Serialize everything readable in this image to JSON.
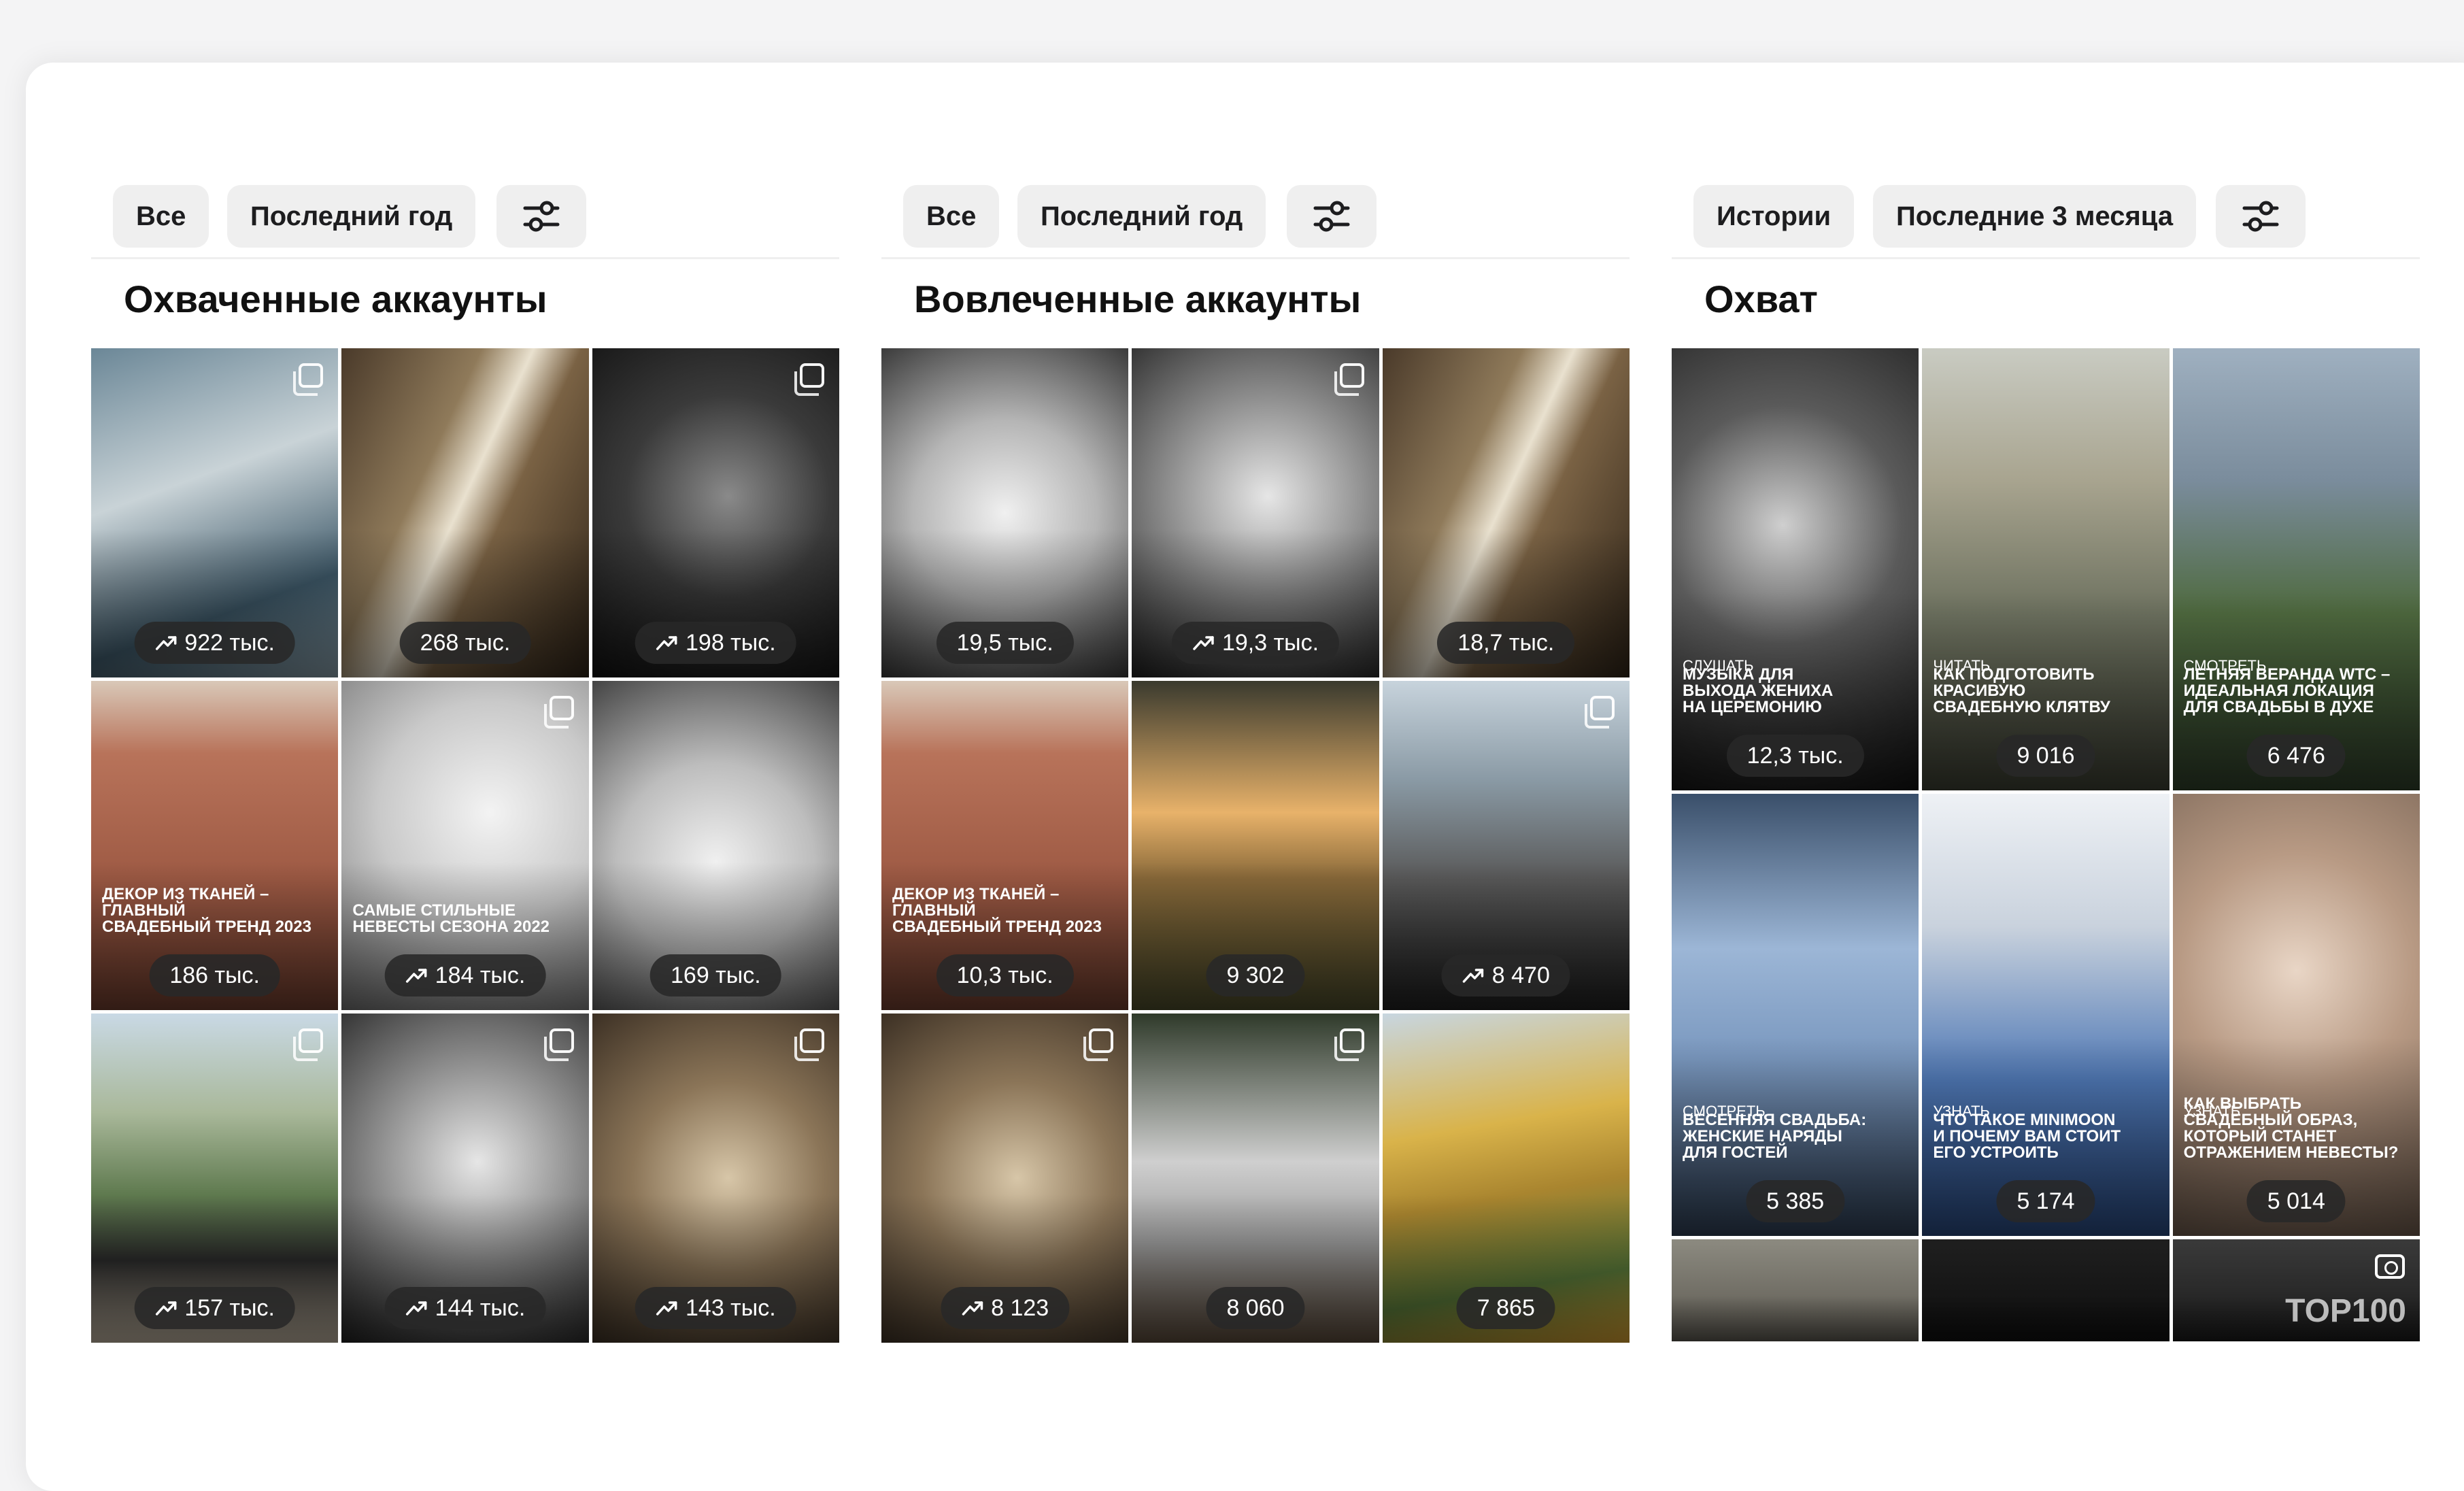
{
  "columns": [
    {
      "chips": [
        "Все",
        "Последний год"
      ],
      "title": "Охваченные аккаунты",
      "tiles": [
        {
          "value": "922 тыс.",
          "trend": true,
          "caption": "",
          "tag": "",
          "badge": true,
          "bg": "linear-gradient(160deg,#6b8797 0%,#c9d3d7 40%,#3f5a6a 75%,#8aa0ab 100%)"
        },
        {
          "value": "268 тыс.",
          "trend": false,
          "caption": "",
          "tag": "",
          "badge": false,
          "bg": "linear-gradient(115deg,#4a3a2a 0%,#8f7a5a 35%,#e9e1cf 48%,#7a6244 60%,#2f2418 100%)"
        },
        {
          "value": "198 тыс.",
          "trend": true,
          "caption": "",
          "tag": "",
          "badge": true,
          "bg": "radial-gradient(circle at 55% 45%,#8a8a8a 0%,#3a3a3a 45%,#111 100%)"
        },
        {
          "value": "186 тыс.",
          "trend": false,
          "caption": "ДЕКОР ИЗ ТКАНЕЙ – ГЛАВНЫЙ\nСВАДЕБНЫЙ ТРЕНД 2023",
          "tag": "",
          "badge": false,
          "bg": "linear-gradient(180deg,#d9c8b8 0%,#b8735a 22%,#9e5a44 60%,#6e3d2e 100%)"
        },
        {
          "value": "184 тыс.",
          "trend": true,
          "caption": "САМЫЕ СТИЛЬНЫЕ\nНЕВЕСТЫ СЕЗОНА 2022",
          "tag": "",
          "badge": true,
          "bg": "radial-gradient(circle at 60% 40%,#f3f3f3 0%,#c9c9c9 45%,#6d6d6d 100%)"
        },
        {
          "value": "169 тыс.",
          "trend": false,
          "caption": "",
          "tag": "",
          "badge": false,
          "bg": "radial-gradient(circle at 50% 55%,#f0f0f0 0%,#bdbdbd 45%,#444 100%)"
        },
        {
          "value": "157 тыс.",
          "trend": true,
          "caption": "",
          "tag": "",
          "badge": true,
          "bg": "linear-gradient(180deg,#c9d9e5 0%,#a9b89a 30%,#5f7a4f 55%,#2a2a2a 75%,#bfb3a0 100%)"
        },
        {
          "value": "144 тыс.",
          "trend": true,
          "caption": "",
          "tag": "",
          "badge": true,
          "bg": "radial-gradient(circle at 55% 45%,#e6e6e6 0%,#8c8c8c 45%,#1f1f1f 100%)"
        },
        {
          "value": "143 тыс.",
          "trend": true,
          "caption": "",
          "tag": "",
          "badge": true,
          "bg": "radial-gradient(circle at 55% 50%,#d7c6a8 0%,#8b7558 45%,#3c3024 100%)"
        }
      ]
    },
    {
      "chips": [
        "Все",
        "Последний год"
      ],
      "title": "Вовлеченные аккаунты",
      "tiles": [
        {
          "value": "19,5 тыс.",
          "trend": false,
          "caption": "",
          "tag": "",
          "badge": false,
          "bg": "radial-gradient(circle at 50% 50%,#f0f0f0 0%,#b5b5b5 45%,#3b3b3b 100%)"
        },
        {
          "value": "19,3 тыс.",
          "trend": true,
          "caption": "",
          "tag": "",
          "badge": true,
          "bg": "radial-gradient(circle at 55% 45%,#e6e6e6 0%,#8c8c8c 45%,#1f1f1f 100%)"
        },
        {
          "value": "18,7 тыс.",
          "trend": false,
          "caption": "",
          "tag": "",
          "badge": false,
          "bg": "linear-gradient(115deg,#4a3a2a 0%,#8f7a5a 35%,#e9e1cf 48%,#7a6244 60%,#2f2418 100%)"
        },
        {
          "value": "10,3 тыс.",
          "trend": false,
          "caption": "ДЕКОР ИЗ ТКАНЕЙ – ГЛАВНЫЙ\nСВАДЕБНЫЙ ТРЕНД 2023",
          "tag": "",
          "badge": false,
          "bg": "linear-gradient(180deg,#d9c8b8 0%,#b8735a 22%,#9e5a44 60%,#6e3d2e 100%)"
        },
        {
          "value": "9 302",
          "trend": false,
          "caption": "",
          "tag": "",
          "badge": false,
          "bg": "linear-gradient(180deg,#3a3a2e 0%,#e8b26a 40%,#8a6a3a 60%,#4a4a2a 100%)"
        },
        {
          "value": "8 470",
          "trend": true,
          "caption": "",
          "tag": "",
          "badge": true,
          "bg": "linear-gradient(180deg,#c7d3dc 0%,#8a9aa5 30%,#5a5a5a 60%,#1f1f1f 100%)"
        },
        {
          "value": "8 123",
          "trend": true,
          "caption": "",
          "tag": "",
          "badge": true,
          "bg": "radial-gradient(circle at 55% 50%,#d7c6a8 0%,#8b7558 45%,#3c3024 100%)"
        },
        {
          "value": "8 060",
          "trend": false,
          "caption": "",
          "tag": "",
          "badge": true,
          "bg": "linear-gradient(180deg,#2f3a2a 0%,#cfcfcf 45%,#9a9a9a 70%,#5a4a3a 100%)"
        },
        {
          "value": "7 865",
          "trend": false,
          "caption": "",
          "tag": "",
          "badge": false,
          "bg": "linear-gradient(170deg,#c8d6e0 0%,#d9b34a 35%,#a9852f 55%,#5a7a3a 80%,#d8a030 100%)"
        }
      ]
    },
    {
      "chips": [
        "Истории",
        "Последние 3 месяца"
      ],
      "title": "Охват",
      "tiles": [
        {
          "value": "12,3 тыс.",
          "trend": false,
          "caption": "МУЗЫКА ДЛЯ\nВЫХОДА ЖЕНИХА\nНА ЦЕРЕМОНИЮ",
          "tag": "СЛУШАТЬ",
          "badge": false,
          "bg": "radial-gradient(circle at 45% 40%,#cfcfcf 0%,#5a5a5a 40%,#111 100%)"
        },
        {
          "value": "9 016",
          "trend": false,
          "caption": "КАК ПОДГОТОВИТЬ\nКРАСИВУЮ\nСВАДЕБНУЮ КЛЯТВУ",
          "tag": "ЧИТАТЬ",
          "badge": false,
          "bg": "linear-gradient(180deg,#c9cbc2 0%,#a8a48f 30%,#6e7260 60%,#3c3f33 100%)"
        },
        {
          "value": "6 476",
          "trend": false,
          "caption": "ЛЕТНЯЯ ВЕРАНДА WTC –\nИДЕАЛЬНАЯ ЛОКАЦИЯ\nДЛЯ СВАДЬБЫ В ДУХЕ",
          "tag": "СМОТРЕТЬ",
          "badge": false,
          "bg": "linear-gradient(180deg,#9fb0c0 0%,#7a8c9c 30%,#4f6a3f 60%,#2f3f2a 100%)"
        },
        {
          "value": "5 385",
          "trend": false,
          "caption": "ВЕСЕННЯЯ СВАДЬБА:\nЖЕНСКИЕ НАРЯДЫ\nДЛЯ ГОСТЕЙ",
          "tag": "СМОТРЕТЬ",
          "badge": false,
          "bg": "linear-gradient(180deg,#3a4f6a 0%,#9cb6d6 35%,#7a98bf 60%,#2f3f55 100%)"
        },
        {
          "value": "5 174",
          "trend": false,
          "caption": "ЧТО ТАКОЕ MINIMOON\nИ ПОЧЕМУ ВАМ СТОИТ\nЕГО УСТРОИТЬ",
          "tag": "УЗНАТЬ",
          "badge": false,
          "bg": "linear-gradient(180deg,#eef1f5 0%,#c9d2dd 30%,#4f78b5 65%,#2a4a80 100%)"
        },
        {
          "value": "5 014",
          "trend": false,
          "caption": "КАК ВЫБРАТЬ\nСВАДЕБНЫЙ ОБРАЗ,\nКОТОРЫЙ СТАНЕТ\nОТРАЖЕНИЕМ НЕВЕСТЫ?",
          "tag": "УЗНАТЬ",
          "badge": false,
          "bg": "radial-gradient(circle at 50% 40%,#e9d6c6 0%,#b89a84 40%,#6d5a4c 100%)"
        },
        {
          "value": "",
          "trend": false,
          "caption": "",
          "tag": "",
          "badge": false,
          "bg": "linear-gradient(180deg,#8c8a80 0%,#5a574f 100%)"
        },
        {
          "value": "",
          "trend": false,
          "caption": "",
          "tag": "",
          "badge": false,
          "bg": "linear-gradient(180deg,#1f1f1f 0%,#0e0e0e 100%)"
        },
        {
          "value": "",
          "trend": false,
          "caption": "TOP100",
          "tag": "",
          "badge": false,
          "cam": true,
          "bg": "linear-gradient(180deg,#3a3a3a 0%,#1a1a1a 100%)"
        }
      ]
    }
  ]
}
